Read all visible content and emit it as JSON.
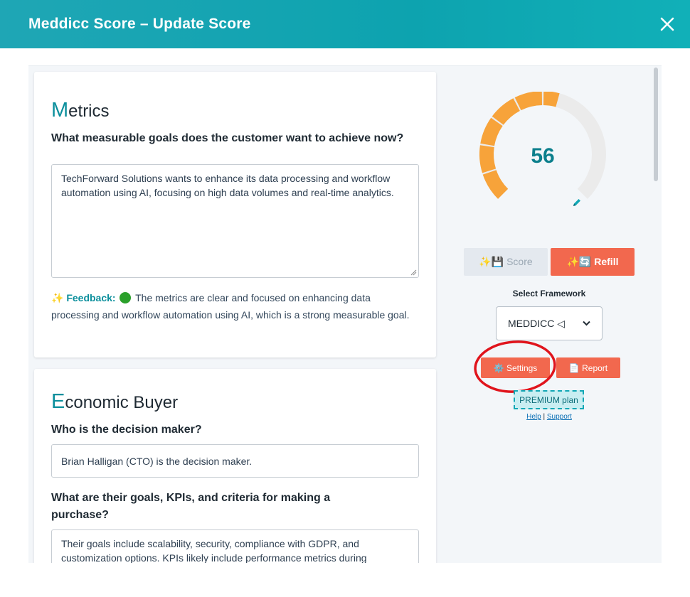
{
  "header": {
    "title": "Meddicc Score – Update Score"
  },
  "metrics": {
    "initial": "M",
    "title_rest": "etrics",
    "question": "What measurable goals does the customer want to achieve now?",
    "answer": "TechForward Solutions wants to enhance its data processing and workflow automation using AI, focusing on high data volumes and real-time analytics.",
    "feedback_icon": "✨",
    "feedback_label": "Feedback:",
    "feedback_status": "green",
    "feedback_text": "The metrics are clear and focused on enhancing data processing and workflow automation using AI, which is a strong measurable goal."
  },
  "economic_buyer": {
    "initial": "E",
    "title_rest": "conomic Buyer",
    "question1": "Who is the decision maker?",
    "answer1": "Brian Halligan (CTO) is the decision maker.",
    "question2": "What are their goals, KPIs, and criteria for making a purchase?",
    "answer2": "Their goals include scalability, security, compliance with GDPR, and customization options. KPIs likely include performance metrics during"
  },
  "score_panel": {
    "score": "56",
    "score_value": 56,
    "score_max": 100,
    "score_button": "✨💾 Score",
    "refill_button": "✨🔄 Refill",
    "framework_label": "Select Framework",
    "framework_selected": "MEDDICC ◁",
    "settings_button": "⚙️ Settings",
    "report_button": "📄 Report",
    "plan_badge": "PREMIUM plan",
    "help_link": "Help",
    "separator": "|",
    "support_link": "Support"
  },
  "colors": {
    "header": "#0da3af",
    "accent": "#0b8f9c",
    "gauge_fill": "#f7a33a",
    "gauge_empty": "#ebebeb",
    "button_primary": "#f2684e",
    "annotation": "#e0141c"
  }
}
